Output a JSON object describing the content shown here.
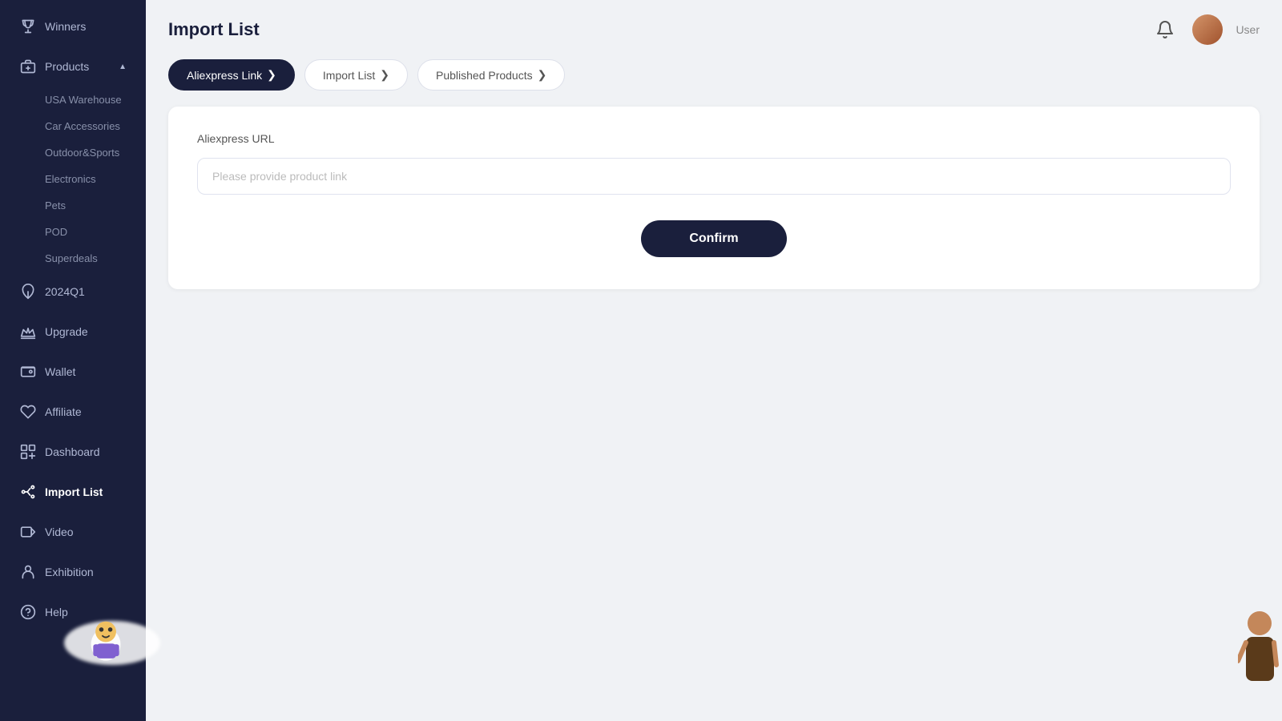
{
  "header": {
    "title": "Import List",
    "notification_label": "notifications",
    "user_name": "User"
  },
  "sidebar": {
    "items": [
      {
        "id": "winners",
        "label": "Winners",
        "icon": "trophy"
      },
      {
        "id": "products",
        "label": "Products",
        "icon": "box",
        "expanded": true,
        "chevron": "▲"
      },
      {
        "id": "usa-warehouse",
        "label": "USA Warehouse",
        "sub": true
      },
      {
        "id": "car-accessories",
        "label": "Car Accessories",
        "sub": true
      },
      {
        "id": "outdoor-sports",
        "label": "Outdoor&Sports",
        "sub": true
      },
      {
        "id": "electronics",
        "label": "Electronics",
        "sub": true
      },
      {
        "id": "pets",
        "label": "Pets",
        "sub": true
      },
      {
        "id": "pod",
        "label": "POD",
        "sub": true
      },
      {
        "id": "superdeals",
        "label": "Superdeals",
        "sub": true
      },
      {
        "id": "2024q1",
        "label": "2024Q1",
        "icon": "leaf"
      },
      {
        "id": "upgrade",
        "label": "Upgrade",
        "icon": "crown"
      },
      {
        "id": "wallet",
        "label": "Wallet",
        "icon": "wallet"
      },
      {
        "id": "affiliate",
        "label": "Affiliate",
        "icon": "heart"
      },
      {
        "id": "dashboard",
        "label": "Dashboard",
        "icon": "chart"
      },
      {
        "id": "import-list",
        "label": "Import List",
        "icon": "nodes",
        "active": true
      },
      {
        "id": "video",
        "label": "Video",
        "icon": "video"
      },
      {
        "id": "exhibition",
        "label": "Exhibition",
        "icon": "person"
      },
      {
        "id": "help",
        "label": "Help",
        "icon": "help"
      }
    ]
  },
  "tabs": [
    {
      "id": "aliexpress-link",
      "label": "Aliexpress Link",
      "active": true,
      "chevron": "❯"
    },
    {
      "id": "import-list",
      "label": "Import  List",
      "active": false,
      "chevron": "❯"
    },
    {
      "id": "published-products",
      "label": "Published Products",
      "active": false,
      "chevron": "❯"
    }
  ],
  "form": {
    "section_label": "Aliexpress URL",
    "input_placeholder": "Please provide product link",
    "confirm_button": "Confirm"
  }
}
